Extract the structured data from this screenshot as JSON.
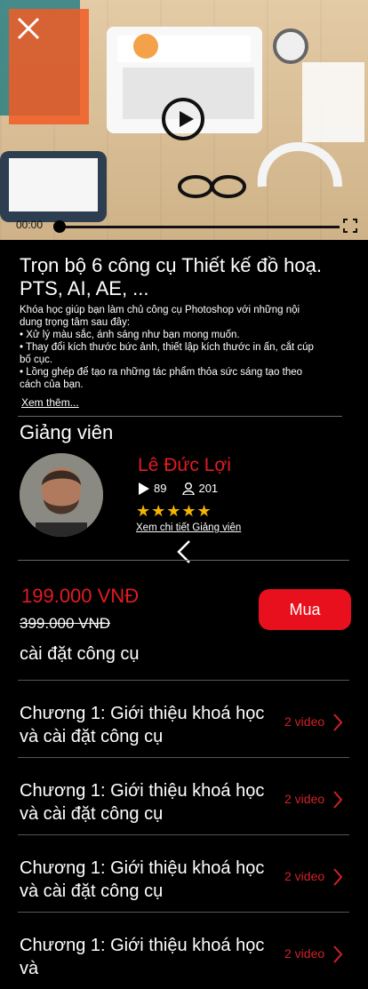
{
  "video": {
    "current_time": "00:00",
    "progress": 0
  },
  "course": {
    "title": "Trọn bộ 6 công cụ Thiết kế đồ hoạ. PTS, AI, AE, ...",
    "description_lines": [
      "Khóa học giúp bạn làm chủ công cụ Photoshop với những nội dung trọng tâm sau đây:",
      "• Xử lý màu sắc, ánh sáng như bạn mong muốn.",
      "• Thay đổi kích thước bức ảnh, thiết lập kích thước in ấn, cắt cúp bố cục.",
      "• Lồng ghép để tạo ra những tác phẩm thỏa sức sáng tạo theo cách của bạn."
    ],
    "see_more": "Xem thêm..."
  },
  "instructor": {
    "section_title": "Giảng viên",
    "name": "Lê Đức Lợi",
    "courses": "89",
    "students": "201",
    "rating": 5,
    "stars": "★★★★★",
    "details_link": "Xem chi tiết Giảng viên"
  },
  "purchase": {
    "price": "199.000 VNĐ",
    "old_price": "399.000 VNĐ",
    "buy_label": "Mua"
  },
  "chapters": {
    "partial_title": "cài đặt công cụ",
    "items": [
      {
        "title": "Chương 1: Giới thiệu khoá học và cài đặt công cụ",
        "count": "2 video"
      },
      {
        "title": "Chương 1: Giới thiệu khoá học và cài đặt công cụ",
        "count": "2 video"
      },
      {
        "title": "Chương 1: Giới thiệu khoá học và cài đặt công cụ",
        "count": "2 video"
      },
      {
        "title": "Chương 1: Giới thiệu khoá học và",
        "count": "2 video"
      }
    ]
  },
  "colors": {
    "accent": "#e31b23",
    "button": "#e8101d",
    "star": "#f5b400"
  }
}
